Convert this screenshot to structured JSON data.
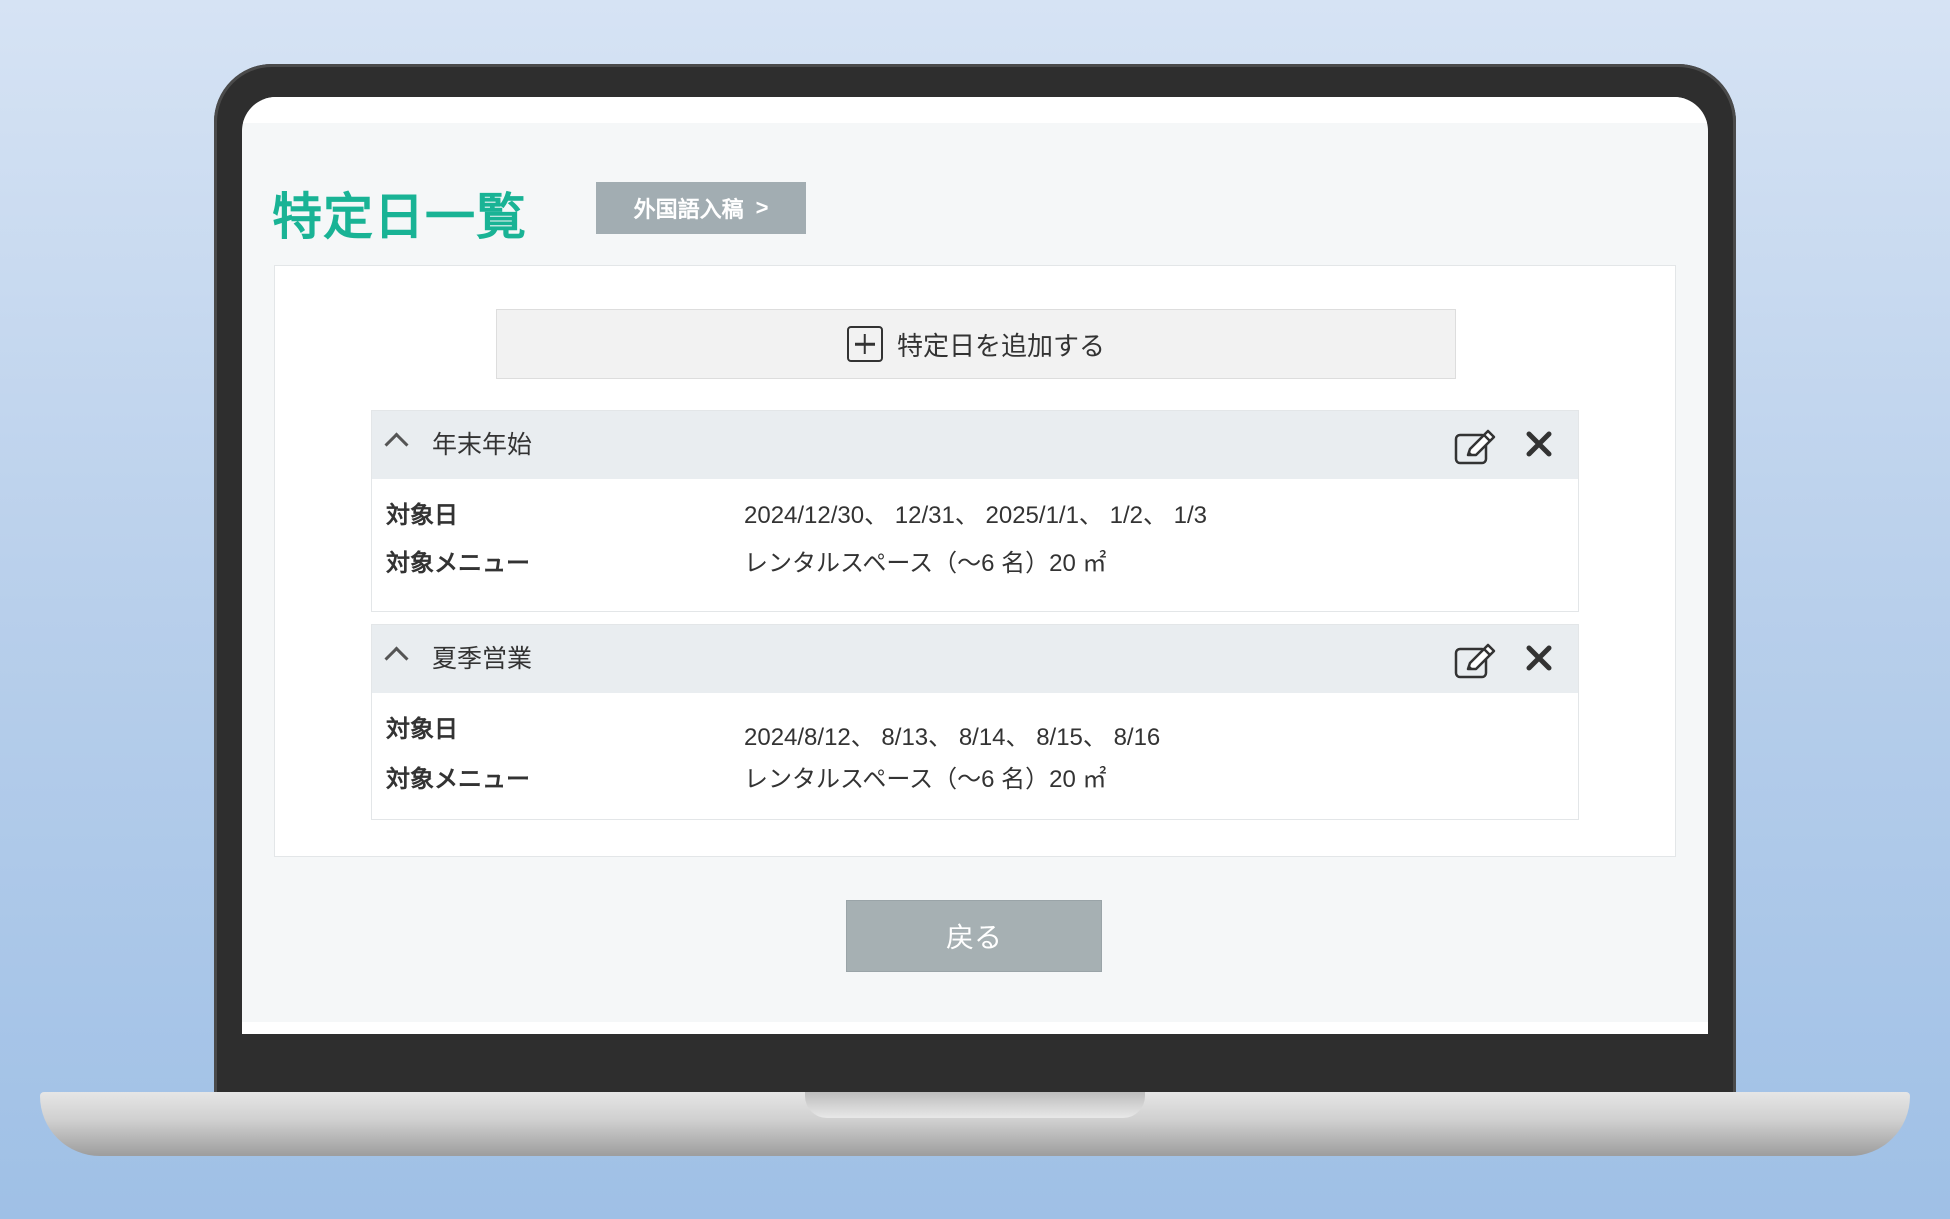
{
  "page": {
    "title": "特定日一覧",
    "foreign_button_label": "外国語入稿",
    "foreign_button_chevron": ">",
    "add_button_label": "特定日を追加する",
    "back_button_label": "戻る"
  },
  "cards": [
    {
      "title": "年末年始",
      "target_date_label": "対象日",
      "target_date_value": "2024/12/30、 12/31、 2025/1/1、 1/2、 1/3",
      "target_menu_label": "対象メニュー",
      "target_menu_value": "レンタルスペース（～6 名）20 ㎡"
    },
    {
      "title": "夏季営業",
      "target_date_label": "対象日",
      "target_date_value": "2024/8/12、 8/13、 8/14、 8/15、 8/16",
      "target_menu_label": "対象メニュー",
      "target_menu_value": "レンタルスペース（～6 名）20 ㎡"
    }
  ],
  "colors": {
    "accent": "#19b395",
    "button_gray": "#a2adb2",
    "header_bg": "#e9edf0"
  },
  "icons": [
    "plus-square-icon",
    "chevron-up-icon",
    "edit-icon",
    "close-icon"
  ]
}
